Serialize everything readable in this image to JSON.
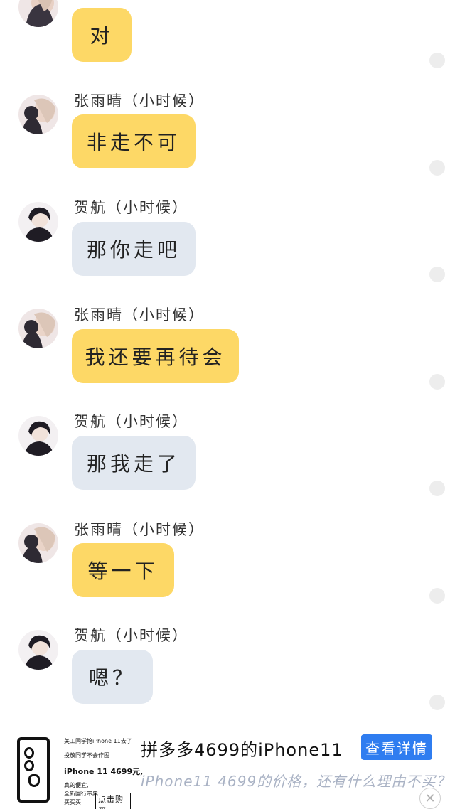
{
  "messages": [
    {
      "sender": "",
      "text": "对",
      "side": "yellow"
    },
    {
      "sender": "张雨晴（小时候）",
      "text": "非走不可",
      "side": "yellow"
    },
    {
      "sender": "贺航（小时候）",
      "text": "那你走吧",
      "side": "gray"
    },
    {
      "sender": "张雨晴（小时候）",
      "text": "我还要再待会",
      "side": "yellow"
    },
    {
      "sender": "贺航（小时候）",
      "text": "那我走了",
      "side": "gray"
    },
    {
      "sender": "张雨晴（小时候）",
      "text": "等一下",
      "side": "yellow"
    },
    {
      "sender": "贺航（小时候）",
      "text": "嗯？",
      "side": "gray"
    }
  ],
  "ad": {
    "image_line1": "美工同学抢iPhone 11去了",
    "image_line2": "投放同学不会作图",
    "image_price": "iPhone 11 4699元,",
    "image_line3": "真的便宜,",
    "image_line4": "全新国行带票",
    "image_line5": "买买买",
    "image_buy_tag": "点击购买",
    "title": "拼多多4699的iPhone11",
    "button_label": "查看详情",
    "description": "iPhone11 4699的价格，还有什么理由不买？",
    "close_glyph": "✕"
  },
  "colors": {
    "bubble_yellow": "#fdd866",
    "bubble_gray": "#e2e8f0",
    "ad_button": "#2f7df0"
  }
}
